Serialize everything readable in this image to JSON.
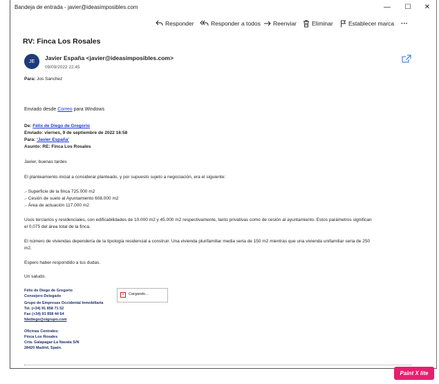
{
  "window": {
    "title": "Bandeja de entrada - javier@ideasimposibles.com",
    "minimize": "—",
    "maximize": "☐",
    "close": "✕"
  },
  "toolbar": {
    "reply": "Responder",
    "reply_all": "Responder a todos",
    "forward": "Reenviar",
    "delete": "Eliminar",
    "flag": "Establecer marca",
    "more": "···"
  },
  "message": {
    "subject": "RV: Finca Los Rosales",
    "avatar_initials": "JE",
    "sender": "Javier España <javier@ideasimposibles.com>",
    "datetime": "09/09/2022 22:45",
    "to_label": "Para:",
    "to_value": "Jos Sanchez"
  },
  "body": {
    "sent_from_prefix": "Enviado desde ",
    "sent_from_link": "Correo",
    "sent_from_suffix": " para Windows",
    "from_label": "De:",
    "from_value": "Félix de Diego de Gregorio",
    "sent_label": "Enviado:",
    "sent_value": "viernes, 9 de septiembre de 2022 16:58",
    "para_label": "Para:",
    "para_value": "'Javier España'",
    "asunto_label": "Asunto:",
    "asunto_value": "RE: Finca Los Rosales",
    "greeting": "Javier, buenas tardes",
    "intro": "El planteamiento inicial a considerar planteado, y por supuesto sujeto a negociación, era el siguiente:",
    "bullet_1": ".- Superficie de la finca 725.000 m2",
    "bullet_2": ".- Cesión de suelo al Ayuntamiento 608.000 m2",
    "bullet_3": ".- Área de actuación 117.000 m2",
    "usos_1": "Usos terciarios y residenciales, con edificabilidades de 10.000 m2 y 45.000 m2 respectivamente, tanto privativas como de cesión al ayuntamiento. Estos parámetros significan",
    "usos_2": "el 0,075 del área total de la finca.",
    "viv_1": "El número de viviendas dependería de la tipología residencial a construir. Una vivienda plurifamiliar media seria de 150 m2 mientras que una vivienda unifamiliar seria de 250",
    "viv_2": "m2.",
    "espero": "Espero haber respondido a tus dudas.",
    "saludo": "Un saludo."
  },
  "signature": {
    "name": "Félix de Diego de Gregorio",
    "role": "Consejero Delegado",
    "company": "Grupo de Empresas Occidental Inmobiliaria",
    "tel": "Tel. (+34) 91 858 71 52",
    "fax": "Fax (+34) 91 858 44 64",
    "email": "fdediego@oigrupo.com",
    "oficinas": "Oficinas Centrales:",
    "finca": "Finca Los Rosales",
    "ctra": "Crta. Galapagar-La Navata S/N",
    "city": "28420 Madrid, Spain."
  },
  "image_placeholder": {
    "text": "Cargando..."
  },
  "badge": {
    "text": "Paint X lite"
  }
}
